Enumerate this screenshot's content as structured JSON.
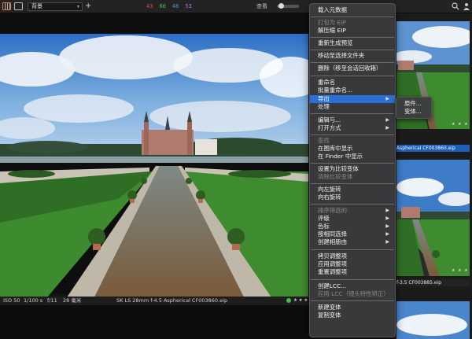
{
  "toolbar": {
    "collection_select": "背景",
    "plus_label": "+",
    "counts": [
      {
        "value": "43",
        "color": "#e04a4a"
      },
      {
        "value": "60",
        "color": "#4bbf5a"
      },
      {
        "value": "48",
        "color": "#5a86e0"
      },
      {
        "value": "53",
        "color": "#b86ad8"
      }
    ],
    "right_label": "查看"
  },
  "photo": {
    "title": "SK LS 28mm f-4.5 Aspherical CF003860.eip",
    "iso": "ISO 50",
    "shutter": "1/100 s",
    "aperture": "f/11",
    "focal": "28 毫米",
    "stars": "★ ★ ★"
  },
  "browser": {
    "thumb1_caption": "Aspherical CF003860.eip",
    "thumb2_caption": "f-3.5 CF003885.eip",
    "stars": "★ ★ ★"
  },
  "context_menu": {
    "items": [
      {
        "label": "载入元数据",
        "disabled": false
      },
      {
        "label": "打包为 EIP",
        "disabled": true
      },
      {
        "label": "解压缩 EIP",
        "disabled": false
      },
      {
        "label": "重新生成预览",
        "disabled": false
      },
      {
        "label": "移动至选择文件夹",
        "disabled": false
      },
      {
        "label": "删除（移至会话回收箱）",
        "disabled": false
      },
      {
        "label": "重命名",
        "disabled": false
      },
      {
        "label": "批量重命名...",
        "disabled": false
      },
      {
        "label": "导出",
        "disabled": false,
        "highlight": true,
        "submenu": true
      },
      {
        "label": "处理",
        "disabled": false
      },
      {
        "label": "编辑与...",
        "disabled": false,
        "submenu": true
      },
      {
        "label": "打开方式",
        "disabled": false,
        "submenu": true
      },
      {
        "label": "查找",
        "disabled": true
      },
      {
        "label": "在图库中显示",
        "disabled": false
      },
      {
        "label": "在 Finder 中显示",
        "disabled": false
      },
      {
        "label": "设置为比较变体",
        "disabled": false
      },
      {
        "label": "清除比较变体",
        "disabled": true
      },
      {
        "label": "向左旋转",
        "disabled": false
      },
      {
        "label": "向右旋转",
        "disabled": false
      },
      {
        "label": "排序筛选的",
        "disabled": true,
        "submenu": true
      },
      {
        "label": "评级",
        "disabled": false,
        "submenu": true
      },
      {
        "label": "色标",
        "disabled": false,
        "submenu": true
      },
      {
        "label": "按相同选择",
        "disabled": false,
        "submenu": true
      },
      {
        "label": "创建相册由",
        "disabled": false,
        "submenu": true
      },
      {
        "label": "拷贝调整项",
        "disabled": false
      },
      {
        "label": "应用调整项",
        "disabled": false
      },
      {
        "label": "重置调整项",
        "disabled": false
      },
      {
        "label": "创建LCC...",
        "disabled": false
      },
      {
        "label": "应用 LCC（镜头特性矫正）",
        "disabled": true
      },
      {
        "label": "新建变体",
        "disabled": false
      },
      {
        "label": "复制变体",
        "disabled": false
      }
    ],
    "submenu_arrow": "▶"
  },
  "export_submenu": {
    "items": [
      "原件...",
      "变体..."
    ]
  },
  "colors": {
    "menu_highlight": "#2a6fd6",
    "selected_caption": "#1f5fb8"
  }
}
